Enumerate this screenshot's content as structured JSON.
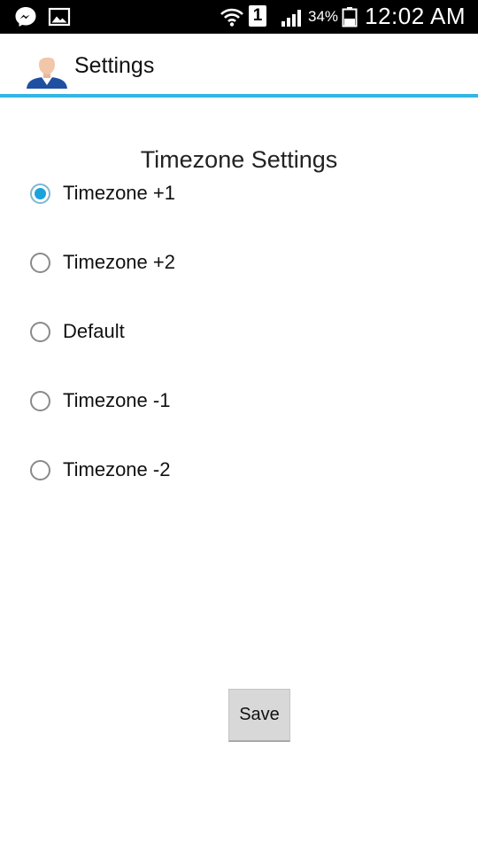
{
  "status_bar": {
    "battery_percent": "34%",
    "sim_slot": "1",
    "time": "12:02 AM",
    "icons": [
      "messenger-icon",
      "gallery-icon",
      "wifi-icon",
      "sim-icon",
      "signal-icon",
      "battery-icon"
    ]
  },
  "action_bar": {
    "title": "Settings",
    "icon": "avatar-icon",
    "accent_color": "#33b5e5"
  },
  "main": {
    "section_title": "Timezone Settings",
    "options": [
      {
        "label": "Timezone +1",
        "checked": true
      },
      {
        "label": "Timezone +2",
        "checked": false
      },
      {
        "label": "Default",
        "checked": false
      },
      {
        "label": "Timezone -1",
        "checked": false
      },
      {
        "label": "Timezone -2",
        "checked": false
      }
    ],
    "save_label": "Save"
  }
}
